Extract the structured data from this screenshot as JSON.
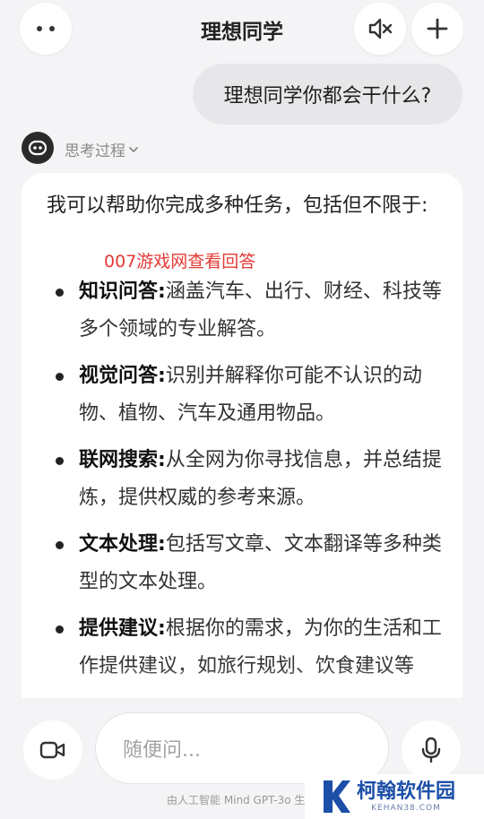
{
  "header": {
    "title": "理想同学"
  },
  "conversation": {
    "user_message": "理想同学你都会干什么?",
    "thinking_label": "思考过程",
    "answer_intro": "我可以帮助你完成多种任务，包括但不限于:",
    "overlay_text": "007游戏网查看回答",
    "items": [
      {
        "title": "知识问答",
        "sep": ":",
        "text": "涵盖汽车、出行、财经、科技等多个领域的专业解答。"
      },
      {
        "title": "视觉问答",
        "sep": ":",
        "text": "识别并解释你可能不认识的动物、植物、汽车及通用物品。"
      },
      {
        "title": "联网搜索",
        "sep": ":",
        "text": "从全网为你寻找信息，并总结提炼，提供权威的参考来源。"
      },
      {
        "title": "文本处理",
        "sep": ":",
        "text": "包括写文章、文本翻译等多种类型的文本处理。"
      },
      {
        "title": "提供建议",
        "sep": ":",
        "text": "根据你的需求，为你的生活和工作提供建议，如旅行规划、饮食建议等"
      }
    ]
  },
  "composer": {
    "placeholder": "随便问..."
  },
  "footer": {
    "note": "由人工智能 Mind GPT-3o 生"
  },
  "watermark": {
    "name": "柯翰软件园",
    "url": "KEHAN38.COM"
  },
  "colors": {
    "background": "#f4f4f6",
    "user_bubble": "#e7e7ea",
    "card": "#ffffff",
    "overlay_red": "#e53935",
    "logo_blue": "#1d4fa8"
  },
  "icons": [
    "more-icon",
    "mute-icon",
    "plus-icon",
    "bot-avatar-icon",
    "chevron-down-icon",
    "video-camera-icon",
    "microphone-icon",
    "k-logo-icon"
  ]
}
